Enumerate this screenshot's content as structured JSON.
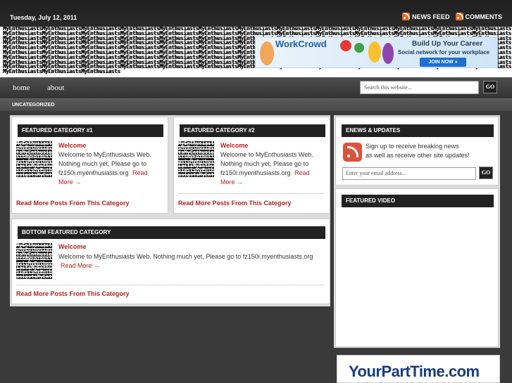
{
  "topbar": {
    "date": "Tuesday, July 12, 2011",
    "news_feed": "NEWS FEED",
    "comments": "COMMENTS"
  },
  "header": {
    "logo_repeat": "MyEnthusiasts",
    "ad": {
      "brand": "WorkCrowd",
      "title": "Build Up Your Career",
      "subtitle": "Social network for your workplace",
      "button": "JOIN NOW »"
    }
  },
  "nav": {
    "items": [
      "home",
      "about"
    ],
    "search_placeholder": "Search this website...",
    "go": "GO"
  },
  "category_bar": "UNCATEGORIZED",
  "featured1": {
    "title": "FEATURED CATEGORY #1",
    "post_title": "Welcome",
    "post_text": "Welcome to MyEnthusiasts Web. Nothing much yet, Please go to fz150i.myenthusiasts.org",
    "read_more": "Read More →",
    "more_posts": "Read More Posts From This Category"
  },
  "featured2": {
    "title": "FEATURED CATEGORY #2",
    "post_title": "Welcome",
    "post_text": "Welcome to MyEnthusiasts Web. Nothing much yet, Please go to fz150i.myenthusiasts.org",
    "read_more": "Read More →",
    "more_posts": "Read More Posts From This Category"
  },
  "bottom": {
    "title": "BOTTOM FEATURED CATEGORY",
    "post_title": "Welcome",
    "post_text": "Welcome to MyEnthusiasts Web. Nothing much yet, Please go to fz150i.myenthusiasts.org",
    "read_more": "Read More →",
    "more_posts": "Read More Posts From This Category"
  },
  "sidebar": {
    "enews_title": "ENEWS & UPDATES",
    "enews_line1": "Sign up to receive breaking news",
    "enews_line2": "as well as receive other site updates!",
    "email_placeholder": "Enter your email address...",
    "go": "GO",
    "video_title": "FEATURED VIDEO",
    "ad_brand": "YourPartTime.com"
  },
  "colors": {
    "accent": "#b22222",
    "dark": "#222222"
  }
}
